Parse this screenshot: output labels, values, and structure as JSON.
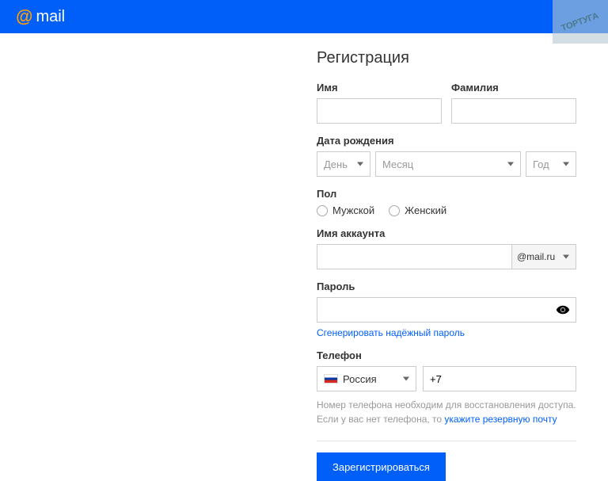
{
  "header": {
    "logo": "mail"
  },
  "watermark": "ТОРТУГА",
  "form": {
    "title": "Регистрация",
    "first_name_label": "Имя",
    "last_name_label": "Фамилия",
    "birthdate_label": "Дата рождения",
    "day_placeholder": "День",
    "month_placeholder": "Месяц",
    "year_placeholder": "Год",
    "gender_label": "Пол",
    "gender_male": "Мужской",
    "gender_female": "Женский",
    "account_label": "Имя аккаунта",
    "domain": "@mail.ru",
    "password_label": "Пароль",
    "generate_password": "Сгенерировать надёжный пароль",
    "phone_label": "Телефон",
    "country": "Россия",
    "phone_prefix": "+7",
    "phone_hint_1": "Номер телефона необходим для восстановления доступа.",
    "phone_hint_2": "Если у вас нет телефона, то ",
    "phone_hint_link": "укажите резервную почту",
    "submit": "Зарегистрироваться"
  }
}
